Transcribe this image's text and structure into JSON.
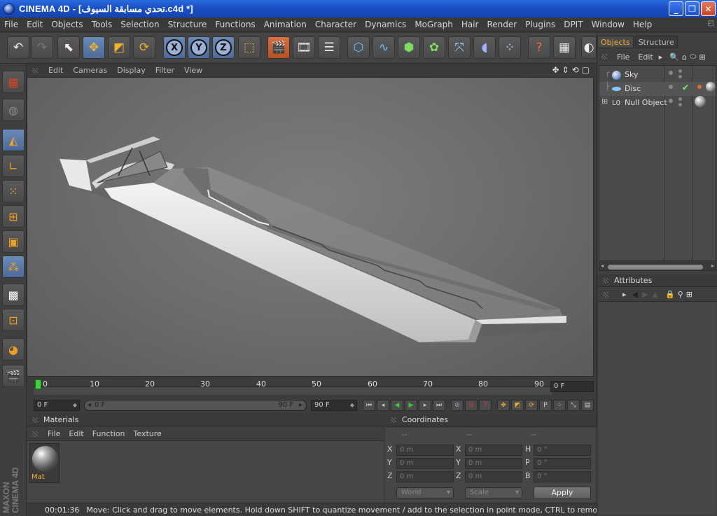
{
  "window": {
    "title": "CINEMA 4D - [تحدي مسابقة السيوف.c4d *]",
    "minimize": "_",
    "maximize": "❐",
    "close": "✕"
  },
  "menubar": [
    "File",
    "Edit",
    "Objects",
    "Tools",
    "Selection",
    "Structure",
    "Functions",
    "Animation",
    "Character",
    "Dynamics",
    "MoGraph",
    "Hair",
    "Render",
    "Plugins",
    "DPIT",
    "Window",
    "Help"
  ],
  "viewport": {
    "menus": [
      "Edit",
      "Cameras",
      "Display",
      "Filter",
      "View"
    ]
  },
  "timeline": {
    "ticks": [
      "0",
      "10",
      "20",
      "30",
      "40",
      "50",
      "60",
      "70",
      "80",
      "90"
    ],
    "current_frame": "0 F"
  },
  "transport": {
    "start": "0 F",
    "range_start": "0 F",
    "range_end": "90 F",
    "end": "90 F"
  },
  "materials": {
    "title": "Materials",
    "menus": [
      "File",
      "Edit",
      "Function",
      "Texture"
    ],
    "items": [
      {
        "name": "Mat"
      }
    ]
  },
  "coordinates": {
    "title": "Coordinates",
    "col_headers": [
      "--",
      "--",
      "--"
    ],
    "rows": [
      {
        "a1": "X",
        "v1": "0 m",
        "a2": "X",
        "v2": "0 m",
        "a3": "H",
        "v3": "0 °"
      },
      {
        "a1": "Y",
        "v1": "0 m",
        "a2": "Y",
        "v2": "0 m",
        "a3": "P",
        "v3": "0 °"
      },
      {
        "a1": "Z",
        "v1": "0 m",
        "a2": "Z",
        "v2": "0 m",
        "a3": "B",
        "v3": "0 °"
      }
    ],
    "space": "World",
    "mode": "Scale",
    "apply": "Apply"
  },
  "status": {
    "time": "00:01:36",
    "message": "Move: Click and drag to move elements. Hold down SHIFT to quantize movement / add to the selection in point mode, CTRL to remove."
  },
  "objects_panel": {
    "tabs": [
      "Objects",
      "Structure"
    ],
    "menus": [
      "File",
      "Edit"
    ],
    "objects": [
      {
        "name": "Sky"
      },
      {
        "name": "Disc"
      },
      {
        "name": "Null Object"
      }
    ]
  },
  "attributes": {
    "title": "Attributes"
  },
  "logo": {
    "line1": "MAXON",
    "line2": "CINEMA 4D"
  }
}
